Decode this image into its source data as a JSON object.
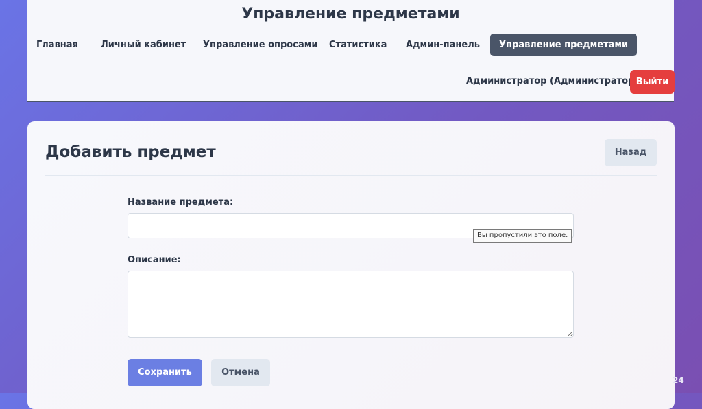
{
  "header": {
    "title": "Управление предметами",
    "nav": [
      {
        "label": "Главная",
        "active": false
      },
      {
        "label": "Личный кабинет",
        "active": false
      },
      {
        "label": "Управление опросами",
        "active": false
      },
      {
        "label": "Статистика",
        "active": false
      },
      {
        "label": "Админ-панель",
        "active": false
      },
      {
        "label": "Управление предметами",
        "active": true
      }
    ],
    "user": "Администратор (Администратор)",
    "logout_label": "Выйти"
  },
  "form": {
    "title": "Добавить предмет",
    "back_label": "Назад",
    "name_label": "Название предмета:",
    "name_value": "",
    "name_tooltip": "Вы пропустили это поле.",
    "description_label": "Описание:",
    "description_value": "",
    "save_label": "Сохранить",
    "cancel_label": "Отмена"
  },
  "slide": {
    "page_number": "24"
  },
  "colors": {
    "accent": "#6b7fe3",
    "danger": "#e53e3e",
    "active_nav": "#4a5568"
  }
}
